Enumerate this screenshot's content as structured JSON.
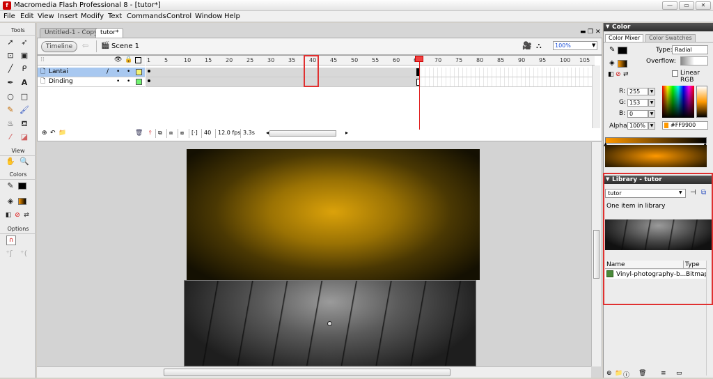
{
  "window": {
    "title": "Macromedia Flash Professional 8 - [tutor*]",
    "min": "—",
    "max": "▭",
    "close": "✕"
  },
  "menu": [
    "File",
    "Edit",
    "View",
    "Insert",
    "Modify",
    "Text",
    "Commands",
    "Control",
    "Window",
    "Help"
  ],
  "toolbox": {
    "tools_label": "Tools",
    "view_label": "View",
    "colors_label": "Colors",
    "options_label": "Options",
    "tool_icons": [
      "arrow-tool",
      "subselect-tool",
      "free-transform-tool",
      "fill-transform-tool",
      "line-tool",
      "lasso-tool",
      "pen-tool",
      "text-tool",
      "oval-tool",
      "rectangle-tool",
      "pencil-tool",
      "brush-tool",
      "ink-bottle-tool",
      "paint-bucket-tool",
      "eyedropper-tool",
      "eraser-tool"
    ],
    "view_icons": [
      "hand-tool",
      "zoom-tool"
    ]
  },
  "tabs": [
    {
      "label": "Untitled-1 - Copy*",
      "active": false
    },
    {
      "label": "tutor*",
      "active": true
    }
  ],
  "editbar": {
    "timeline_button": "Timeline",
    "scene": "Scene 1",
    "zoom": "100%"
  },
  "timeline": {
    "layers": [
      {
        "name": "Lantai",
        "selected": true,
        "color": "#f3f371"
      },
      {
        "name": "Dinding",
        "selected": false,
        "color": "#71f371"
      }
    ],
    "ruler": [
      "1",
      "5",
      "10",
      "15",
      "20",
      "25",
      "30",
      "35",
      "40",
      "45",
      "50",
      "55",
      "60",
      "65",
      "70",
      "75",
      "80",
      "85",
      "90",
      "95",
      "100",
      "105"
    ],
    "current_frame": "40",
    "fps": "12.0 fps",
    "time": "3.3s"
  },
  "color_mixer": {
    "tabs": [
      "Color Mixer",
      "Color Swatches"
    ],
    "panel_title": "Color",
    "type_label": "Type:",
    "type_value": "Radial",
    "overflow_label": "Overflow:",
    "linear_rgb": "Linear RGB",
    "r_label": "R:",
    "r": "255",
    "g_label": "G:",
    "g": "153",
    "b_label": "B:",
    "b": "0",
    "alpha_label": "Alpha:",
    "alpha": "100%",
    "hex": "#FF9900"
  },
  "library": {
    "panel_title": "Library - tutor",
    "selector": "tutor",
    "count_text": "One item in library",
    "col_name": "Name",
    "col_type": "Type",
    "items": [
      {
        "name": "Vinyl-photography-b...",
        "type": "Bitmap"
      }
    ]
  }
}
